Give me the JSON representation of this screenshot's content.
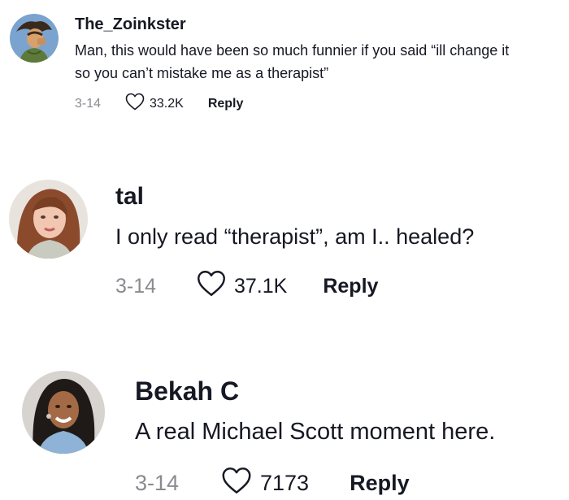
{
  "comments": [
    {
      "username": "The_Zoinkster",
      "text_lines": [
        "Man, this would have been so much funnier if you said “ill change it",
        "so you can’t mistake me as a therapist”"
      ],
      "date": "3-14",
      "likes": "33.2K",
      "reply_label": "Reply",
      "avatar_icon": "cartoon-character-avatar"
    },
    {
      "username": "tal",
      "text_lines": [
        "I only read “therapist”, am I.. healed?"
      ],
      "date": "3-14",
      "likes": "37.1K",
      "reply_label": "Reply",
      "avatar_icon": "user-photo-avatar"
    },
    {
      "username": "Bekah C",
      "text_lines": [
        "A real Michael Scott moment here."
      ],
      "date": "3-14",
      "likes": "7173",
      "reply_label": "Reply",
      "avatar_icon": "user-photo-avatar"
    }
  ],
  "colors": {
    "text": "#161823",
    "muted": "#8a8b91",
    "heart_stroke": "#161823"
  }
}
